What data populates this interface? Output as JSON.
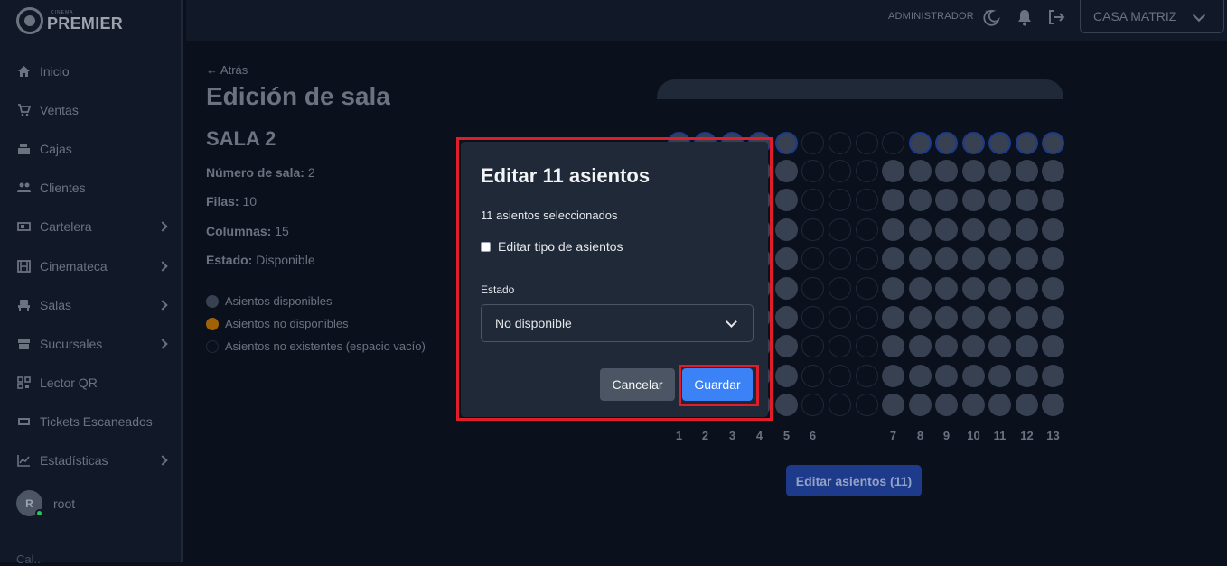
{
  "brand": {
    "small": "CINEMA",
    "name": "PREMIER"
  },
  "sidebar": {
    "items": [
      {
        "label": "Inicio",
        "icon": "home-icon",
        "has_submenu": false
      },
      {
        "label": "Ventas",
        "icon": "cart-icon",
        "has_submenu": false
      },
      {
        "label": "Cajas",
        "icon": "cash-register-icon",
        "has_submenu": false
      },
      {
        "label": "Clientes",
        "icon": "users-icon",
        "has_submenu": false
      },
      {
        "label": "Cartelera",
        "icon": "ticket-icon",
        "has_submenu": true
      },
      {
        "label": "Cinemateca",
        "icon": "film-icon",
        "has_submenu": true
      },
      {
        "label": "Salas",
        "icon": "seat-icon",
        "has_submenu": true
      },
      {
        "label": "Sucursales",
        "icon": "store-icon",
        "has_submenu": true
      },
      {
        "label": "Lector QR",
        "icon": "qr-icon",
        "has_submenu": false
      },
      {
        "label": "Tickets Escaneados",
        "icon": "scanned-ticket-icon",
        "has_submenu": false
      },
      {
        "label": "Estadísticas",
        "icon": "chart-icon",
        "has_submenu": true
      }
    ],
    "user": {
      "initial": "R",
      "name": "root"
    },
    "cutoff_text": "Cal..."
  },
  "header": {
    "role": "ADMINISTRADOR",
    "branch": "CASA MATRIZ"
  },
  "page": {
    "back_label": "Atrás",
    "title": "Edición de sala",
    "sala_name": "SALA 2",
    "info": [
      {
        "key": "Número de sala:",
        "value": " 2"
      },
      {
        "key": "Filas:",
        "value": " 10"
      },
      {
        "key": "Columnas:",
        "value": " 15"
      },
      {
        "key": "Estado:",
        "value": " Disponible"
      }
    ],
    "legend": [
      {
        "label": "Asientos disponibles",
        "color": "#374151"
      },
      {
        "label": "Asientos no disponibles",
        "color": "#a16207"
      },
      {
        "label": "Asientos no existentes (espacio vacío)",
        "color": "transparent"
      }
    ],
    "column_numbers": [
      "1",
      "2",
      "3",
      "4",
      "5",
      "6",
      "7",
      "8",
      "9",
      "10",
      "11",
      "12",
      "13"
    ],
    "edit_seats_button": "Editar asientos (11)"
  },
  "modal": {
    "title": "Editar 11 asientos",
    "selected_text": "11 asientos seleccionados",
    "checkbox_label": "Editar tipo de asientos",
    "checkbox_checked": false,
    "estado_label": "Estado",
    "estado_value": "No disponible",
    "cancel_label": "Cancelar",
    "save_label": "Guardar"
  },
  "colors": {
    "accent": "#3b82f6",
    "highlight": "#e11d2a"
  }
}
